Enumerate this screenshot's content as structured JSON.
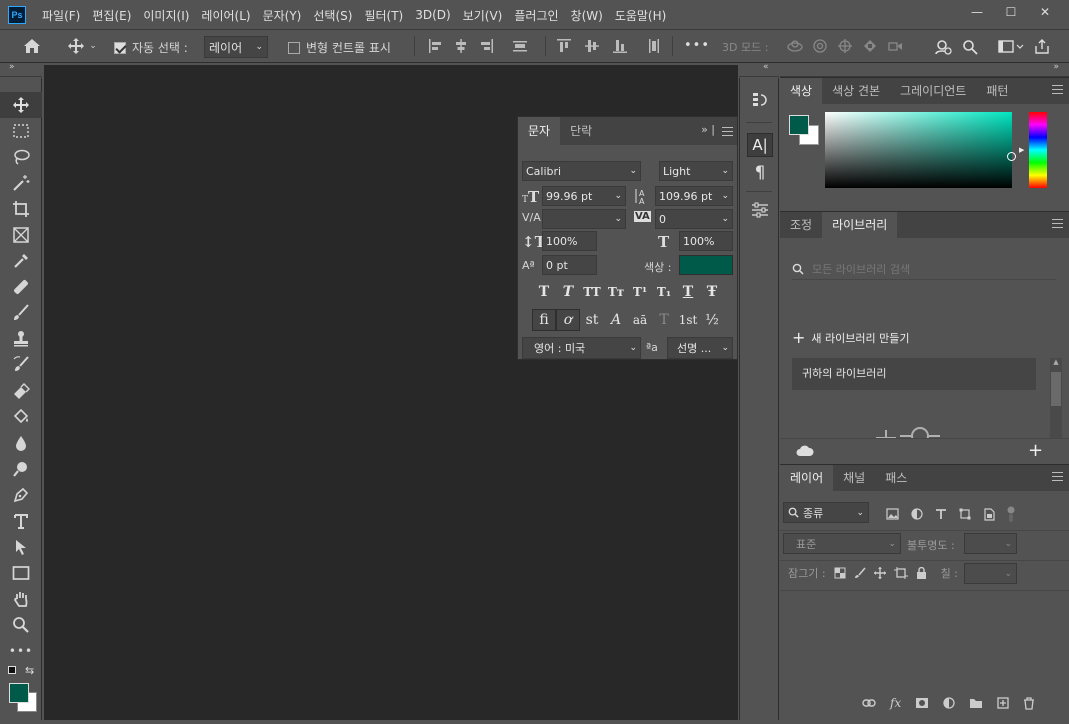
{
  "app": {
    "logo": "Ps"
  },
  "menu": [
    "파일(F)",
    "편집(E)",
    "이미지(I)",
    "레이어(L)",
    "문자(Y)",
    "선택(S)",
    "필터(T)",
    "3D(D)",
    "보기(V)",
    "플러그인",
    "창(W)",
    "도움말(H)"
  ],
  "window_controls": {
    "minimize": "—",
    "maximize": "☐",
    "close": "✕"
  },
  "options": {
    "auto_select_label": "자동 선택 :",
    "auto_select_value": "레이어",
    "transform_label": "변형 컨트롤 표시",
    "more": "•••",
    "mode_3d": "3D 모드 :"
  },
  "character_panel": {
    "tabs": [
      "문자",
      "단락"
    ],
    "font_family": "Calibri",
    "font_style": "Light",
    "font_size": "99.96 pt",
    "leading": "109.96 pt",
    "kerning": "",
    "tracking": "0",
    "vertical_scale": "100%",
    "horizontal_scale": "100%",
    "baseline_shift": "0 pt",
    "color_label": "색상 :",
    "text_color": "#005a4a",
    "style_buttons": [
      "T",
      "T",
      "TT",
      "Tт",
      "T¹",
      "T₁",
      "T",
      "Ŧ"
    ],
    "opentype_buttons": [
      "fi",
      "ơ",
      "st",
      "A",
      "aā",
      "T",
      "1st",
      "½"
    ],
    "language": "영어 : 미국",
    "antialias_icon": "ªa",
    "antialias": "선명 ..."
  },
  "color_panel": {
    "tabs": [
      "색상",
      "색상 견본",
      "그레이디언트",
      "패턴"
    ],
    "foreground": "#005a4a",
    "background": "#ffffff",
    "hue_color": "#00e5c0"
  },
  "library_panel": {
    "tabs": [
      "조정",
      "라이브러리"
    ],
    "search_placeholder": "모든 라이브러리 검색",
    "create_label": "새 라이브러리 만들기",
    "library_item": "귀하의 라이브러리"
  },
  "layers_panel": {
    "tabs": [
      "레이어",
      "채널",
      "패스"
    ],
    "filter_label": "종류",
    "blend_mode": "표준",
    "opacity_label": "불투명도 :",
    "lock_label": "잠그기 :",
    "fill_label": "칠 :"
  }
}
